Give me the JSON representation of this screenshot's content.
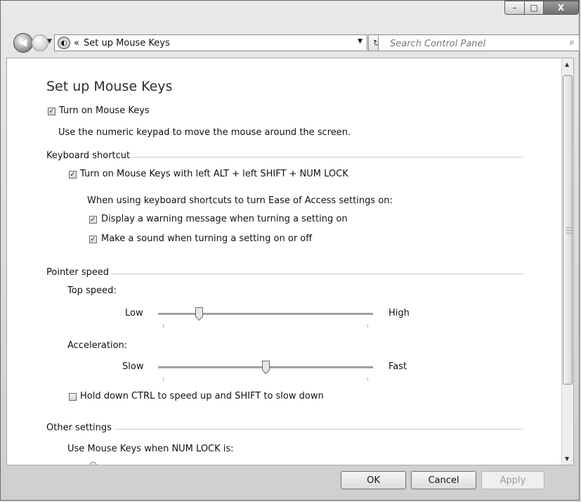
{
  "window": {
    "controls": {
      "minimize_glyph": "–",
      "maximize_glyph": "□",
      "close_glyph": "X"
    }
  },
  "navbar": {
    "back_glyph": "◀",
    "address": {
      "icon": "control-panel-icon",
      "chevron": "«",
      "path": "Set up Mouse Keys"
    },
    "refresh_glyph": "↻",
    "search": {
      "placeholder": "Search Control Panel"
    }
  },
  "page": {
    "title": "Set up Mouse Keys",
    "turn_on": {
      "label": "Turn on Mouse Keys",
      "checked": true
    },
    "turn_on_description": "Use the numeric keypad to move the mouse around the screen.",
    "keyboard_shortcut": {
      "heading": "Keyboard shortcut",
      "shortcut": {
        "label": "Turn on Mouse Keys with left ALT + left SHIFT + NUM LOCK",
        "checked": true
      },
      "ease_intro": "When using keyboard shortcuts to turn Ease of Access settings on:",
      "warning": {
        "label": "Display a warning message when turning a setting on",
        "checked": true
      },
      "sound": {
        "label": "Make a sound when turning a setting on or off",
        "checked": true
      }
    },
    "pointer_speed": {
      "heading": "Pointer speed",
      "top_speed": {
        "label": "Top speed:",
        "min_label": "Low",
        "max_label": "High",
        "value_fraction": 0.18
      },
      "acceleration": {
        "label": "Acceleration:",
        "min_label": "Slow",
        "max_label": "Fast",
        "value_fraction": 0.5
      },
      "hold_ctrl": {
        "label": "Hold down CTRL to speed up and SHIFT to slow down",
        "checked": false
      }
    },
    "other_settings": {
      "heading": "Other settings",
      "numlock_label": "Use Mouse Keys when NUM LOCK is:"
    }
  },
  "footer": {
    "ok": "OK",
    "cancel": "Cancel",
    "apply": "Apply"
  },
  "check_glyph": "✓"
}
